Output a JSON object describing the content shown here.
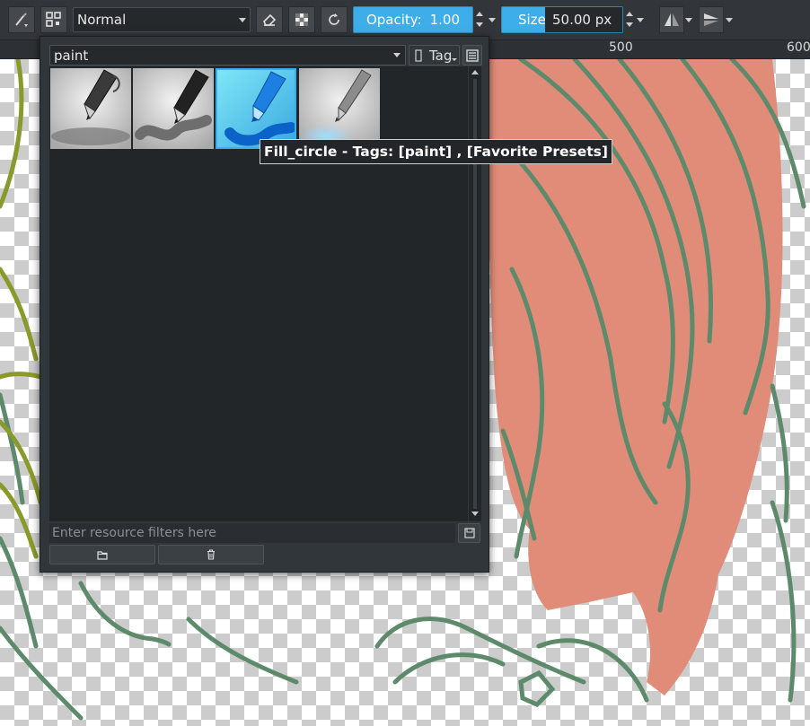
{
  "toolbar": {
    "blend_mode": "Normal",
    "opacity_label": "Opacity:",
    "opacity_value": "1.00",
    "size_label": "Size:",
    "size_value": "50.00 px",
    "accent_color": "#3daee9"
  },
  "ruler": {
    "labels": [
      "500",
      "600"
    ]
  },
  "preset_popup": {
    "tag_filter": "paint",
    "tag_button": "Tag",
    "filter_placeholder": "Enter resource filters here",
    "presets": [
      {
        "icon": "ink-pen-icon",
        "selected": false
      },
      {
        "icon": "marker-pen-icon",
        "selected": false
      },
      {
        "icon": "fill-circle-brush-icon",
        "selected": true
      },
      {
        "icon": "airbrush-pen-icon",
        "selected": false
      }
    ],
    "import_icon": "folder-icon",
    "delete_icon": "trash-icon"
  },
  "tooltip": {
    "text": "Fill_circle - Tags: [paint] , [Favorite Presets]"
  },
  "canvas": {
    "hair_color": "#e08c78",
    "line_color": "#5e8a6c",
    "line_color_alt": "#8a9a2a"
  }
}
